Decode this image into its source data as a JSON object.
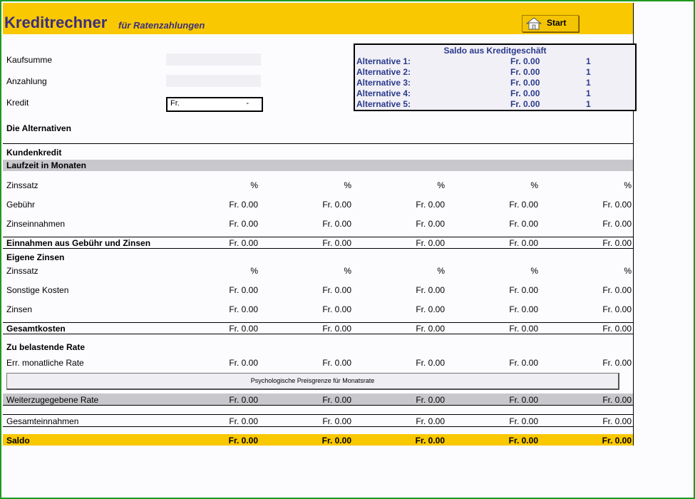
{
  "header": {
    "title": "Kreditrechner",
    "subtitle": "für Ratenzahlungen",
    "start_label": "Start"
  },
  "inputs": {
    "kaufsumme_label": "Kaufsumme",
    "anzahlung_label": "Anzahlung",
    "kredit_label": "Kredit",
    "kredit_currency": "Fr.",
    "kredit_value": "-"
  },
  "saldo": {
    "title": "Saldo aus Kreditgeschäft",
    "rows": [
      {
        "label": "Alternative 1:",
        "value": "Fr. 0.00",
        "num": "1"
      },
      {
        "label": "Alternative 2:",
        "value": "Fr. 0.00",
        "num": "1"
      },
      {
        "label": "Alternative 3:",
        "value": "Fr. 0.00",
        "num": "1"
      },
      {
        "label": "Alternative 4:",
        "value": "Fr. 0.00",
        "num": "1"
      },
      {
        "label": "Alternative 5:",
        "value": "Fr. 0.00",
        "num": "1"
      }
    ]
  },
  "sections": {
    "alternativen": "Die Alternativen",
    "kundenkredit": "Kundenkredit",
    "laufzeit": "Laufzeit in Monaten",
    "eigene_zinsen": "Eigene Zinsen",
    "zu_belastende": "Zu belastende Rate"
  },
  "rows": {
    "zinssatz1": {
      "label": "Zinssatz",
      "vals": [
        "%",
        "%",
        "%",
        "%",
        "%"
      ]
    },
    "gebuehr": {
      "label": "Gebühr",
      "vals": [
        "Fr. 0.00",
        "Fr. 0.00",
        "Fr. 0.00",
        "Fr. 0.00",
        "Fr. 0.00"
      ]
    },
    "zinseinnahmen": {
      "label": "Zinseinnahmen",
      "vals": [
        "Fr. 0.00",
        "Fr. 0.00",
        "Fr. 0.00",
        "Fr. 0.00",
        "Fr. 0.00"
      ]
    },
    "einnahmen": {
      "label": "Einnahmen aus Gebühr und Zinsen",
      "vals": [
        "Fr. 0.00",
        "Fr. 0.00",
        "Fr. 0.00",
        "Fr. 0.00",
        "Fr. 0.00"
      ]
    },
    "zinssatz2": {
      "label": "Zinssatz",
      "vals": [
        "%",
        "%",
        "%",
        "%",
        "%"
      ]
    },
    "sonstige": {
      "label": "Sonstige Kosten",
      "vals": [
        "Fr. 0.00",
        "Fr. 0.00",
        "Fr. 0.00",
        "Fr. 0.00",
        "Fr. 0.00"
      ]
    },
    "zinsen": {
      "label": "Zinsen",
      "vals": [
        "Fr. 0.00",
        "Fr. 0.00",
        "Fr. 0.00",
        "Fr. 0.00",
        "Fr. 0.00"
      ]
    },
    "gesamtkosten": {
      "label": "Gesamtkosten",
      "vals": [
        "Fr. 0.00",
        "Fr. 0.00",
        "Fr. 0.00",
        "Fr. 0.00",
        "Fr. 0.00"
      ]
    },
    "err_rate": {
      "label": "Err. monatliche Rate",
      "vals": [
        "Fr. 0.00",
        "Fr. 0.00",
        "Fr. 0.00",
        "Fr. 0.00",
        "Fr. 0.00"
      ]
    },
    "weiter_rate": {
      "label": "Weiterzugegebene Rate",
      "vals": [
        "Fr. 0.00",
        "Fr. 0.00",
        "Fr. 0.00",
        "Fr. 0.00",
        "Fr. 0.00"
      ]
    },
    "gesamteinnahmen": {
      "label": "Gesamteinnahmen",
      "vals": [
        "Fr. 0.00",
        "Fr. 0.00",
        "Fr. 0.00",
        "Fr. 0.00",
        "Fr. 0.00"
      ]
    },
    "saldo": {
      "label": "Saldo",
      "vals": [
        "Fr. 0.00",
        "Fr. 0.00",
        "Fr. 0.00",
        "Fr. 0.00",
        "Fr. 0.00"
      ]
    }
  },
  "psych_button": "Psychologische Preisgrenze für Monatsrate",
  "colors": {
    "header": "#f9c800",
    "title": "#3b2f7e",
    "saldo_text": "#2a3a8c",
    "frame": "#1f9a1f"
  }
}
